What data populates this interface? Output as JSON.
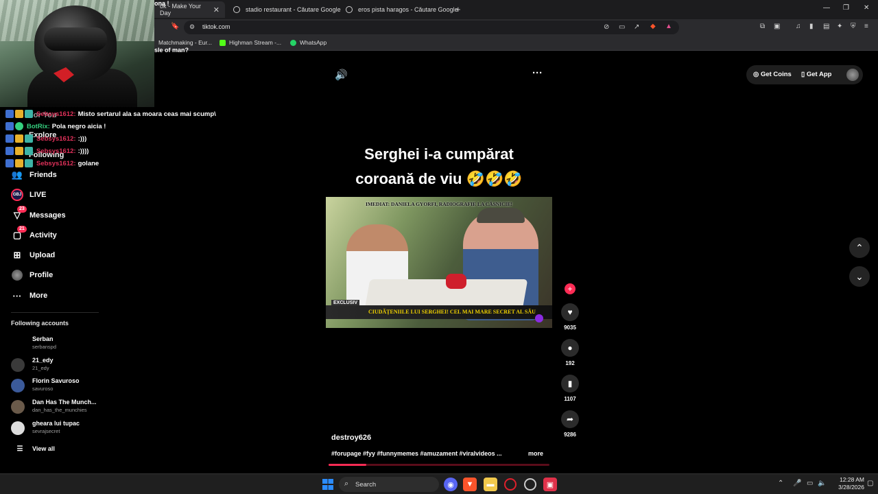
{
  "browser": {
    "tabs": [
      {
        "label": "ok - Make Your Day",
        "active": true
      },
      {
        "label": "stadio restaurant - Căutare Google",
        "active": false
      },
      {
        "label": "eros pista haragos - Căutare Google",
        "active": false
      }
    ],
    "url": "tiktok.com",
    "bookmarks": [
      {
        "label": "Matchmaking - Eur..."
      },
      {
        "label": "Highman Stream -..."
      },
      {
        "label": "WhatsApp"
      }
    ]
  },
  "overlay": {
    "title_fragment": "ona !",
    "question_fragment": "sle of man?",
    "chat": [
      {
        "user": "Sebsys1612:",
        "message": "Misto sertarul ala sa moara ceas mai scump\\",
        "user_color": "#e0315a"
      },
      {
        "user": "BotRix:",
        "message": "Pola negro aicia !",
        "user_color": "#35d07f"
      },
      {
        "user": "Sebsys1612:",
        "message": ":)))",
        "user_color": "#e0315a"
      },
      {
        "user": "Sebsys1612:",
        "message": ":))))",
        "user_color": "#e0315a"
      },
      {
        "user": "Sebsys1612:",
        "message": "golane",
        "user_color": "#e0315a"
      }
    ]
  },
  "nav": {
    "ghost_items": [
      "For You",
      "Explore",
      "Following"
    ],
    "items": [
      {
        "label": "Friends",
        "icon": "friends-icon"
      },
      {
        "label": "LIVE",
        "icon": "live-icon"
      },
      {
        "label": "Messages",
        "icon": "messages-icon",
        "badge": "23"
      },
      {
        "label": "Activity",
        "icon": "activity-icon",
        "badge": "21"
      },
      {
        "label": "Upload",
        "icon": "upload-icon"
      },
      {
        "label": "Profile",
        "icon": "profile-icon"
      },
      {
        "label": "More",
        "icon": "more-icon"
      }
    ],
    "following_header": "Following accounts",
    "accounts": [
      {
        "name": "Serban",
        "handle": "serbanspd"
      },
      {
        "name": "21_edy",
        "handle": "21_edy"
      },
      {
        "name": "Florin Savuroso",
        "handle": "savuroso"
      },
      {
        "name": "Dan Has The Munch...",
        "handle": "dan_has_the_munchies"
      },
      {
        "name": "gheara lui tupac",
        "handle": "sevrajsecret"
      }
    ],
    "view_all": "View all"
  },
  "header": {
    "get_coins": "Get Coins",
    "get_app": "Get App"
  },
  "video": {
    "caption_line1": "Serghei i-a cumpărat",
    "caption_line2": "coroană de viu 🤣🤣🤣",
    "headline": "IMEDIAT: DANIELA GYORFI, RADIOGRAFIE LA CĂSNICIE!",
    "lower_third": "CIUDĂȚENIILE LUI SERGHEI! CEL MAI MARE SECRET AL SĂU",
    "exclusiv": "EXCLUSIV",
    "author": "destroy626",
    "tags": "#forupage #fyy #funnymemes #amuzament #viralvideos ...",
    "more": "more",
    "progress": 0.17,
    "likes": "9035",
    "comments": "192",
    "saves": "1107",
    "shares": "9286"
  },
  "taskbar": {
    "search": "Search",
    "time": "12:28 AM",
    "date": "3/28/2026"
  },
  "colors": {
    "accent": "#fe2c55",
    "background": "#000000"
  }
}
